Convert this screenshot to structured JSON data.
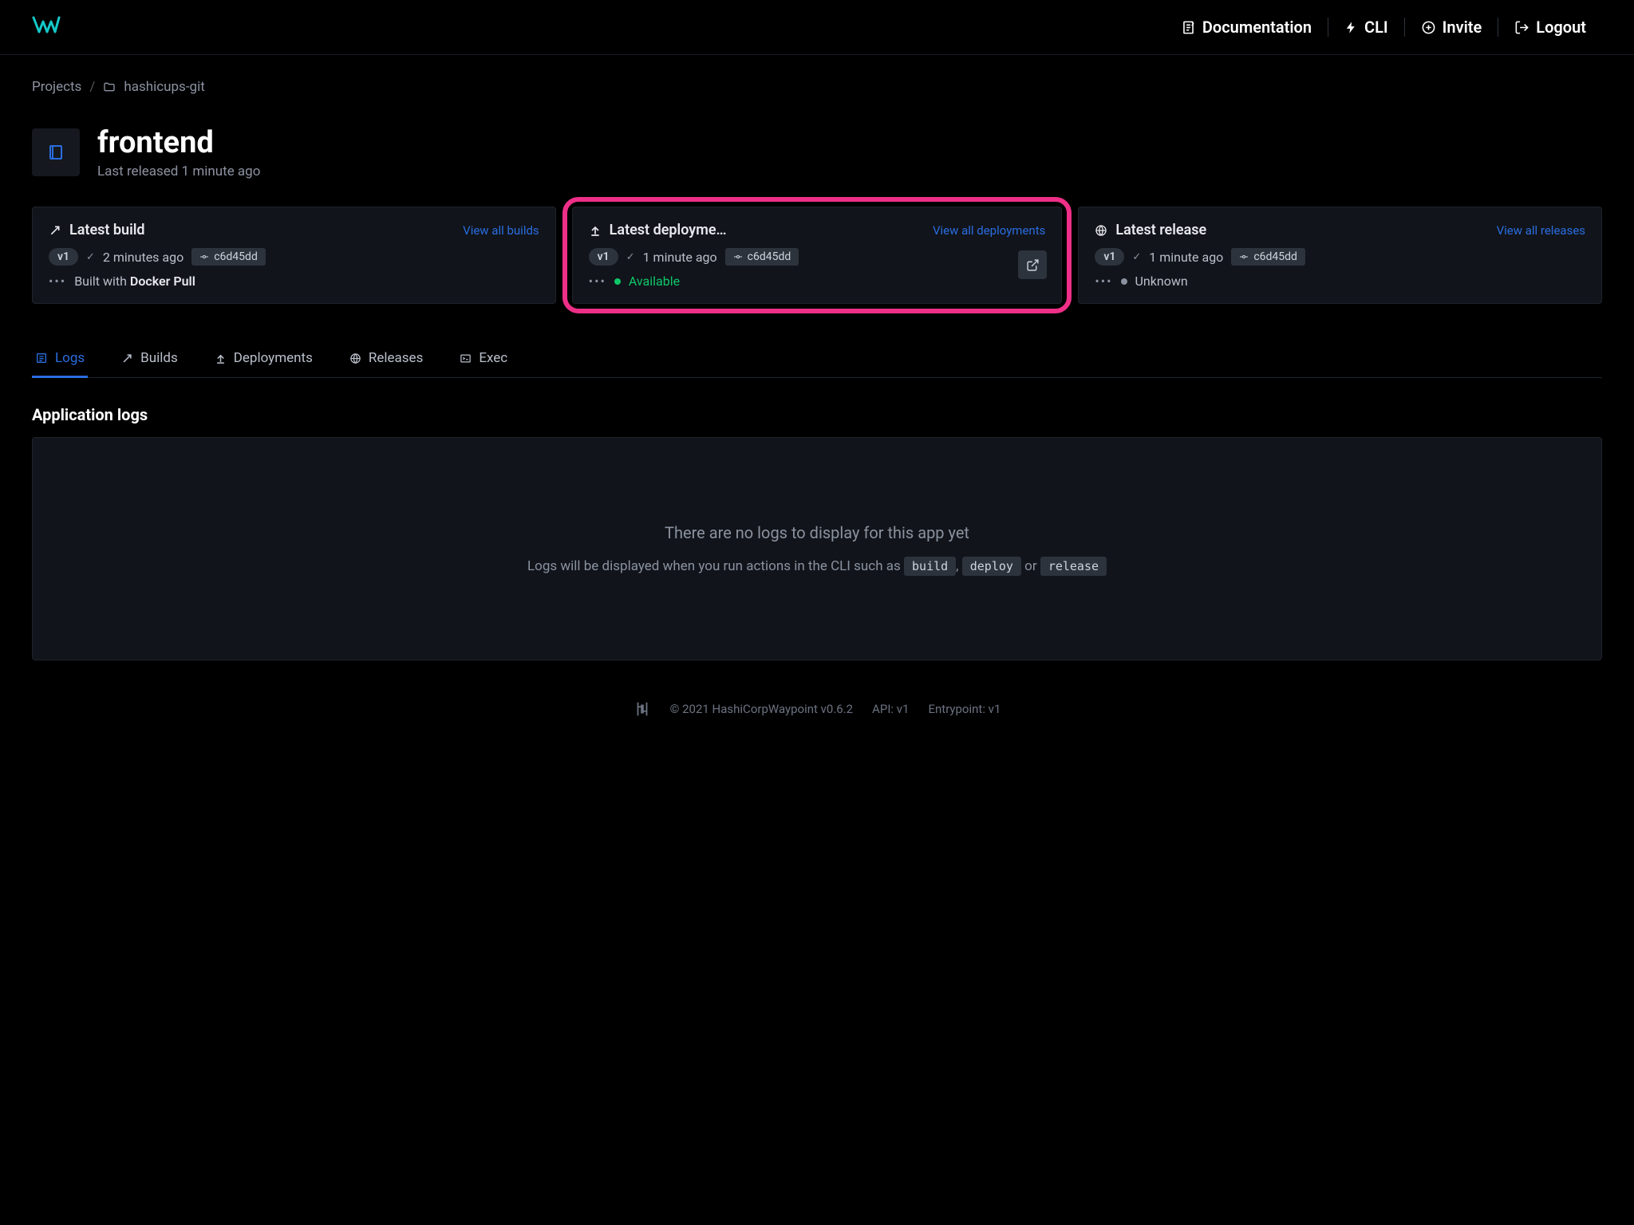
{
  "nav": {
    "documentation": "Documentation",
    "cli": "CLI",
    "invite": "Invite",
    "logout": "Logout"
  },
  "breadcrumb": {
    "projects": "Projects",
    "project_name": "hashicups-git"
  },
  "app": {
    "name": "frontend",
    "subtitle": "Last released 1 minute ago"
  },
  "cards": {
    "build": {
      "title": "Latest build",
      "link": "View all builds",
      "version": "v1",
      "time": "2 minutes ago",
      "hash": "c6d45dd",
      "built_prefix": "Built with ",
      "built_method": "Docker Pull"
    },
    "deployment": {
      "title": "Latest deployme…",
      "link": "View all deployments",
      "version": "v1",
      "time": "1 minute ago",
      "hash": "c6d45dd",
      "status": "Available"
    },
    "release": {
      "title": "Latest release",
      "link": "View all releases",
      "version": "v1",
      "time": "1 minute ago",
      "hash": "c6d45dd",
      "status": "Unknown"
    }
  },
  "tabs": {
    "logs": "Logs",
    "builds": "Builds",
    "deployments": "Deployments",
    "releases": "Releases",
    "exec": "Exec"
  },
  "logs": {
    "section_title": "Application logs",
    "empty_title": "There are no logs to display for this app yet",
    "empty_prefix": "Logs will be displayed when you run actions in the CLI such as ",
    "cmd1": "build",
    "sep1": ", ",
    "cmd2": "deploy",
    "sep2": " or ",
    "cmd3": "release"
  },
  "footer": {
    "copyright": "© 2021 HashiCorpWaypoint v0.6.2",
    "api": "API: v1",
    "entrypoint": "Entrypoint: v1"
  }
}
